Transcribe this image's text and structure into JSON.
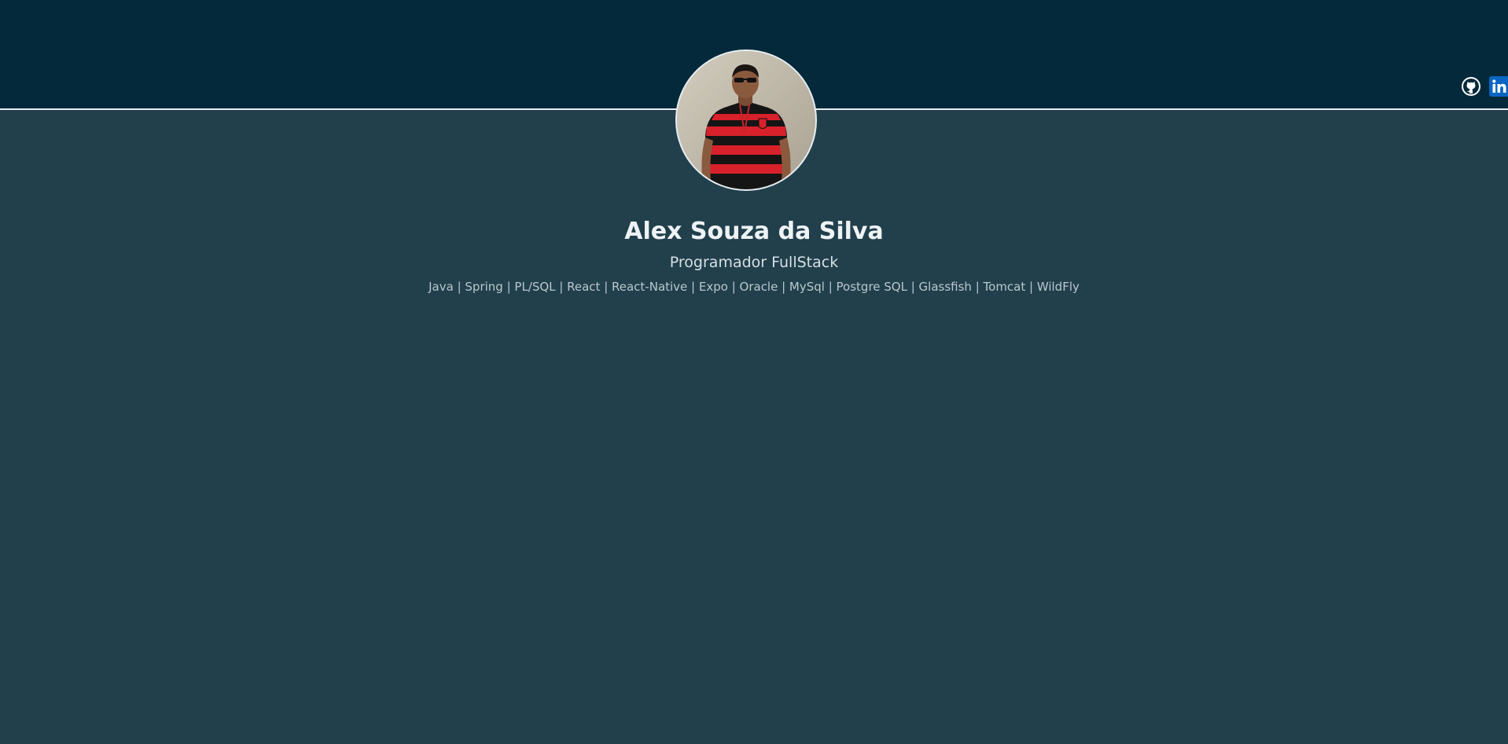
{
  "profile": {
    "name": "Alex Souza da Silva",
    "role": "Programador FullStack",
    "skills": "Java | Spring | PL/SQL | React | React-Native | Expo | Oracle | MySql | Postgre SQL | Glassfish | Tomcat | WildFly"
  },
  "social": {
    "github_icon": "github-icon",
    "linkedin_icon": "linkedin-icon",
    "linkedin_text": "in"
  },
  "colors": {
    "header_bg": "#04293a",
    "page_bg": "#223f4c",
    "linkedin_blue": "#0a66c2",
    "text_light": "#eef3f5"
  }
}
